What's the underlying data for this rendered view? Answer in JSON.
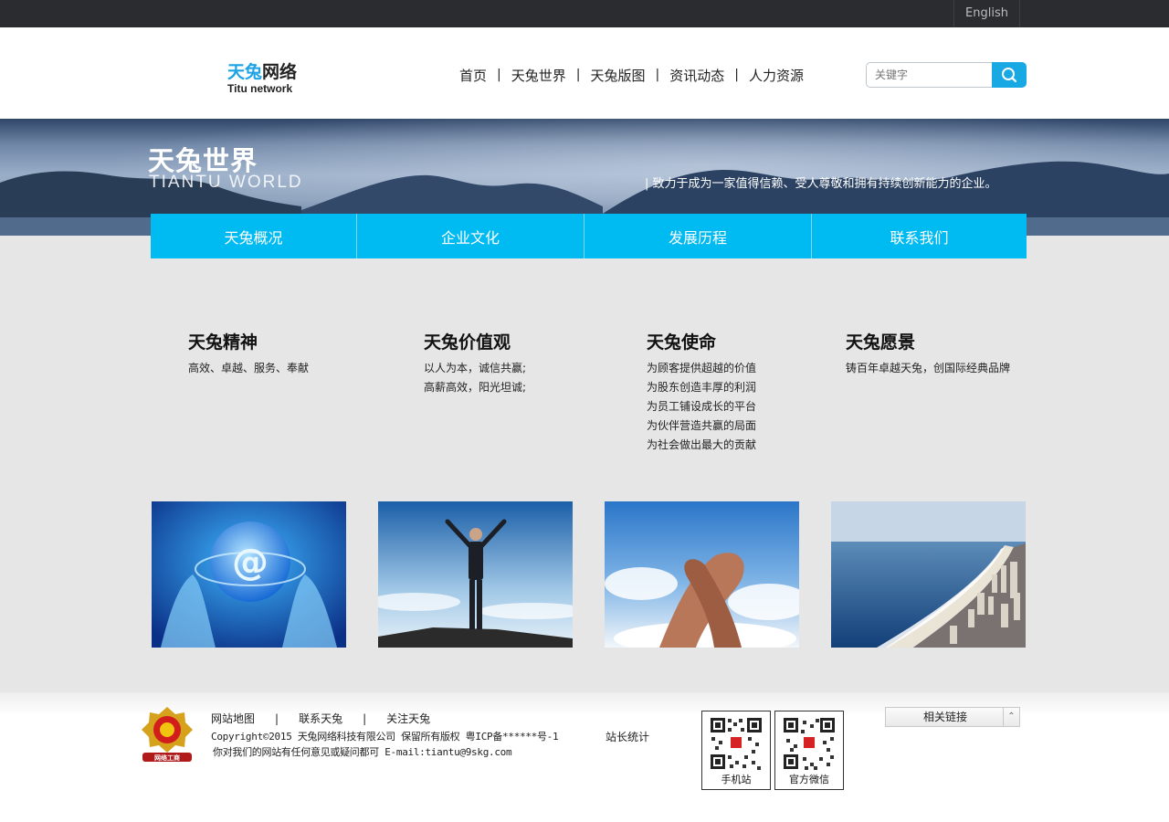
{
  "topbar": {
    "language": "English"
  },
  "header": {
    "logo": {
      "cn_part1": "天兔",
      "cn_part2": "网络",
      "en": "Titu network"
    },
    "nav": [
      {
        "label": "首页"
      },
      {
        "label": "天兔世界"
      },
      {
        "label": "天兔版图"
      },
      {
        "label": "资讯动态"
      },
      {
        "label": "人力资源"
      }
    ],
    "search": {
      "placeholder": "关键字",
      "icon": "search-icon"
    }
  },
  "banner": {
    "title": "天兔世界",
    "subtitle": "TIANTU WORLD",
    "slogan": "| 致力于成为一家值得信赖、受人尊敬和拥有持续创新能力的企业。"
  },
  "tabs": [
    {
      "label": "天兔概况"
    },
    {
      "label": "企业文化"
    },
    {
      "label": "发展历程"
    },
    {
      "label": "联系我们"
    }
  ],
  "values": [
    {
      "title": "天兔精神",
      "lines": [
        "高效、卓越、服务、奉献"
      ]
    },
    {
      "title": "天兔价值观",
      "lines": [
        "以人为本，诚信共赢;",
        "高薪高效，阳光坦诚;"
      ]
    },
    {
      "title": "天兔使命",
      "lines": [
        "为顾客提供超越的价值",
        "为股东创造丰厚的利润",
        "为员工铺设成长的平台",
        "为伙伴营造共赢的局面",
        "为社会做出最大的贡献"
      ]
    },
    {
      "title": "天兔愿景",
      "lines": [
        "铸百年卓越天兔，创国际经典品牌"
      ]
    }
  ],
  "photos": [
    "globe-hands-photo",
    "businessman-sky-photo",
    "handshake-photo",
    "coastline-photo"
  ],
  "footer": {
    "links": [
      {
        "label": "网站地图"
      },
      {
        "label": "联系天兔"
      },
      {
        "label": "关注天兔"
      }
    ],
    "link_separator": "|",
    "copyright": "Copyright©2015 天兔网络科技有限公司 保留所有版权 粤ICP备******号-1",
    "stats": "站长统计",
    "contact": "你对我们的网站有任何意见或疑问都可 E-mail:tiantu@9skg.com",
    "badge_text": "网络工商",
    "qr": [
      {
        "caption": "手机站"
      },
      {
        "caption": "官方微信"
      }
    ],
    "related_links": "相关链接"
  },
  "colors": {
    "accent": "#00baf2",
    "topbar": "#2b2c30",
    "main_bg": "#e6e6e6",
    "search_btn": "#18a8e4"
  }
}
